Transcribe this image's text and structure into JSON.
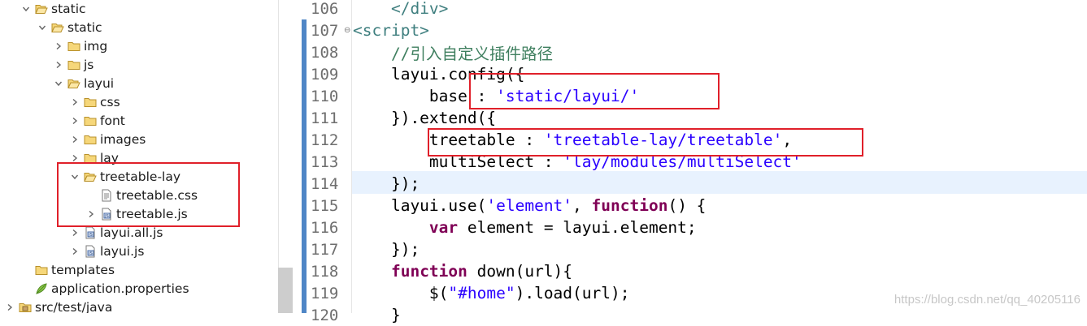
{
  "tree": {
    "items": [
      {
        "label": "static",
        "expanded": true,
        "icon": "folder-open-icon"
      },
      {
        "label": "static",
        "expanded": true,
        "icon": "folder-open-icon"
      },
      {
        "label": "img",
        "expanded": false,
        "icon": "folder-icon"
      },
      {
        "label": "js",
        "expanded": false,
        "icon": "folder-icon"
      },
      {
        "label": "layui",
        "expanded": true,
        "icon": "folder-open-icon"
      },
      {
        "label": "css",
        "expanded": false,
        "icon": "folder-icon"
      },
      {
        "label": "font",
        "expanded": false,
        "icon": "folder-icon"
      },
      {
        "label": "images",
        "expanded": false,
        "icon": "folder-icon"
      },
      {
        "label": "lay",
        "expanded": false,
        "icon": "folder-icon"
      },
      {
        "label": "treetable-lay",
        "expanded": true,
        "icon": "folder-open-icon"
      },
      {
        "label": "treetable.css",
        "expanded": null,
        "icon": "css-file-icon"
      },
      {
        "label": "treetable.js",
        "expanded": false,
        "icon": "js-file-icon"
      },
      {
        "label": "layui.all.js",
        "expanded": false,
        "icon": "js-file-icon"
      },
      {
        "label": "layui.js",
        "expanded": false,
        "icon": "js-file-icon"
      },
      {
        "label": "templates",
        "expanded": null,
        "icon": "folder-icon"
      },
      {
        "label": "application.properties",
        "expanded": null,
        "icon": "properties-file-icon"
      },
      {
        "label": "src/test/java",
        "expanded": false,
        "icon": "source-folder-icon"
      }
    ]
  },
  "editor": {
    "lines": [
      {
        "num": "106",
        "text": "    </div>"
      },
      {
        "num": "107",
        "text": "<script>"
      },
      {
        "num": "108",
        "text": "    //引入自定义插件路径"
      },
      {
        "num": "109",
        "text": "    layui.config({"
      },
      {
        "num": "110",
        "text": "        base : 'static/layui/'"
      },
      {
        "num": "111",
        "text": "    }).extend({"
      },
      {
        "num": "112",
        "text": "        treetable : 'treetable-lay/treetable',"
      },
      {
        "num": "113",
        "text": "        multiSelect : 'lay/modules/multiSelect'"
      },
      {
        "num": "114",
        "text": "    });"
      },
      {
        "num": "115",
        "text": "    layui.use('element', function() {"
      },
      {
        "num": "116",
        "text": "        var element = layui.element;"
      },
      {
        "num": "117",
        "text": "    });"
      },
      {
        "num": "118",
        "text": "    function down(url){"
      },
      {
        "num": "119",
        "text": "        $(\"#home\").load(url);"
      },
      {
        "num": "120",
        "text": "    }"
      }
    ],
    "current_line": "114"
  },
  "watermark": "https://blog.csdn.net/qq_40205116",
  "colors": {
    "keyword": "#7f0055",
    "string": "#2a00ff",
    "comment": "#3f7f5f",
    "annotation_box": "#e0202a",
    "current_line": "#e8f2fe"
  }
}
